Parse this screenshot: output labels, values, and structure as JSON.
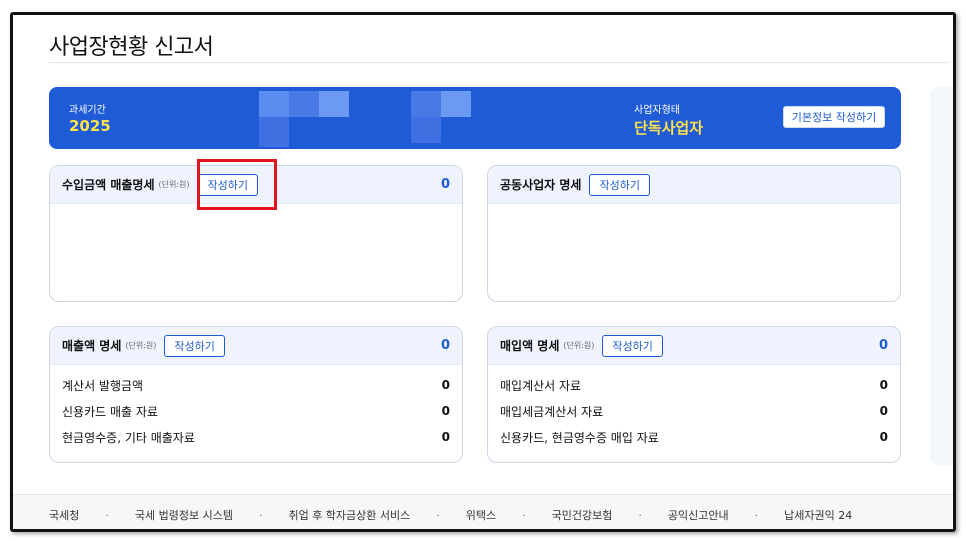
{
  "page": {
    "title": "사업장현황 신고서"
  },
  "banner": {
    "period_label": "과세기간",
    "period_value": "2025",
    "biz_type_label": "사업자형태",
    "biz_type_value": "단독사업자",
    "basic_info_button": "기본정보 작성하기",
    "colors": {
      "background": "#1f5bd6",
      "value": "#ffe14a"
    }
  },
  "cards": {
    "income_sales": {
      "title": "수입금액 매출명세",
      "unit": "(단위:원)",
      "button": "작성하기",
      "count": "0"
    },
    "joint_business": {
      "title": "공동사업자 명세",
      "button": "작성하기"
    },
    "sales": {
      "title": "매출액 명세",
      "unit": "(단위:원)",
      "button": "작성하기",
      "count": "0",
      "rows": [
        {
          "label": "계산서 발행금액",
          "value": "0"
        },
        {
          "label": "신용카드 매출 자료",
          "value": "0"
        },
        {
          "label": "현금영수증, 기타 매출자료",
          "value": "0"
        }
      ]
    },
    "purchase": {
      "title": "매입액 명세",
      "unit": "(단위:원)",
      "button": "작성하기",
      "count": "0",
      "rows": [
        {
          "label": "매입계산서 자료",
          "value": "0"
        },
        {
          "label": "매입세금계산서 자료",
          "value": "0"
        },
        {
          "label": "신용카드, 현금영수증 매입 자료",
          "value": "0"
        }
      ]
    }
  },
  "footer": {
    "links": [
      "국세청",
      "국세 법령정보 시스템",
      "취업 후 학자금상환 서비스",
      "위택스",
      "국민건강보험",
      "공익신고안내",
      "납세자권익 24"
    ],
    "separator": "·"
  },
  "accent_colors": {
    "primary": "#1f5bd6",
    "highlight": "#e2141d"
  }
}
